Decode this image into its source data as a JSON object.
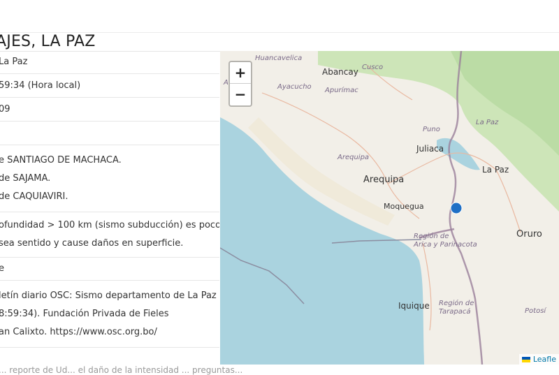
{
  "page_title": "AJES, LA PAZ",
  "info_rows": [
    {
      "lines": [
        "La Paz"
      ]
    },
    {
      "lines": [
        "59:34 (Hora local)"
      ]
    },
    {
      "lines": [
        "09"
      ]
    },
    {
      "lines": [
        ""
      ]
    },
    {
      "lines": [
        "e SANTIAGO DE MACHACA.",
        "de SAJAMA.",
        "de CAQUIAVIRI."
      ]
    },
    {
      "lines": [
        "ofundidad > 100 km (sismo subducción) es poco",
        "sea sentido y cause daños en superficie."
      ]
    },
    {
      "lines": [
        "e"
      ]
    },
    {
      "lines": [
        "letín diario OSC: Sismo departamento de La Paz",
        "8:59:34). Fundación Privada de Fieles",
        "an Calixto. https://www.osc.org.bo/"
      ]
    }
  ],
  "map": {
    "zoom_in": "+",
    "zoom_out": "−",
    "attribution": "Leafle",
    "marker_color": "#1f6fc5",
    "labels": {
      "huancavelica": "Huancavelica",
      "abancay": "Abancay",
      "cusco": "Cusco",
      "ayacucho": "Ayacucho",
      "apurimac": "Apurímac",
      "puno": "Puno",
      "juliaca": "Juliaca",
      "la_paz_region": "La Paz",
      "la_paz_city": "La Paz",
      "arequipa_region": "Arequipa",
      "arequipa_city": "Arequipa",
      "moquegua": "Moquegua",
      "oruro": "Oruro",
      "arica": "Región de\nArica y Parinacota",
      "iquique": "Iquique",
      "tarapaca": "Región de\nTarapacá",
      "potosi": "Potosí",
      "a": "A"
    }
  },
  "footer_fragment": "... reporte de Ud... el daño de la intensidad ... preguntas..."
}
